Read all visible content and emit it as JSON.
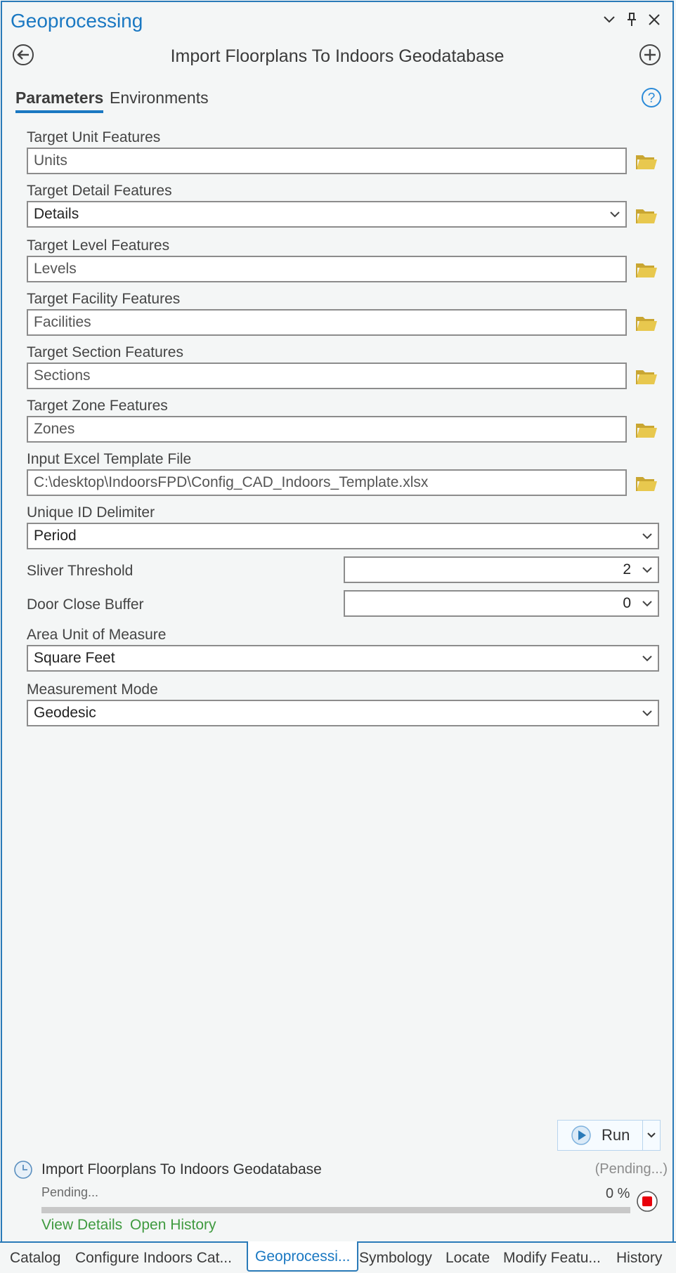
{
  "pane": {
    "title": "Geoprocessing",
    "tool_name": "Import Floorplans To Indoors Geodatabase"
  },
  "tabs": {
    "parameters": "Parameters",
    "environments": "Environments"
  },
  "params": {
    "target_unit": {
      "label": "Target Unit Features",
      "value": "Units"
    },
    "target_detail": {
      "label": "Target Detail Features",
      "value": "Details"
    },
    "target_level": {
      "label": "Target Level Features",
      "value": "Levels"
    },
    "target_facility": {
      "label": "Target Facility Features",
      "value": "Facilities"
    },
    "target_section": {
      "label": "Target Section Features",
      "value": "Sections"
    },
    "target_zone": {
      "label": "Target Zone Features",
      "value": "Zones"
    },
    "excel_template": {
      "label": "Input Excel Template File",
      "value": "C:\\desktop\\IndoorsFPD\\Config_CAD_Indoors_Template.xlsx"
    },
    "unique_id_delimiter": {
      "label": "Unique ID Delimiter",
      "value": "Period"
    },
    "sliver_threshold": {
      "label": "Sliver Threshold",
      "value": "2"
    },
    "door_close_buffer": {
      "label": "Door Close Buffer",
      "value": "0"
    },
    "area_unit": {
      "label": "Area Unit of Measure",
      "value": "Square Feet"
    },
    "measurement_mode": {
      "label": "Measurement Mode",
      "value": "Geodesic"
    }
  },
  "run": {
    "label": "Run"
  },
  "history": {
    "tool_name": "Import Floorplans To Indoors Geodatabase",
    "status": "(Pending...)",
    "pending_text": "Pending...",
    "percent": "0 %",
    "progress": 0,
    "view_details": "View Details",
    "open_history": "Open History"
  },
  "bottom_tabs": [
    "Catalog",
    "Configure Indoors Cat...",
    "Geoprocessi...",
    "Symbology",
    "Locate",
    "Modify Featu...",
    "History"
  ],
  "colors": {
    "accent": "#1a78c2",
    "folder": "#e2c24a",
    "link": "#3f9a3f",
    "stop": "#e8000b"
  }
}
